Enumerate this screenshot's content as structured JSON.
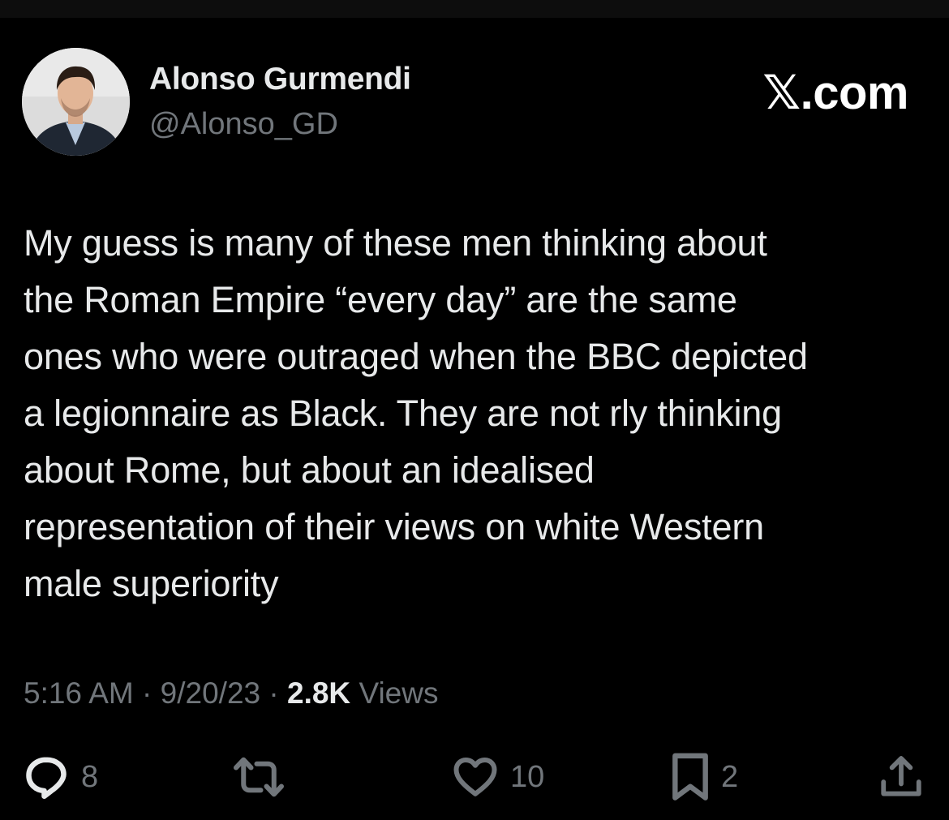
{
  "author": {
    "display_name": "Alonso Gurmendi",
    "handle": "@Alonso_GD",
    "avatar_icon": "profile-photo"
  },
  "brand": "𝕏.com",
  "tweet": {
    "text_lines": [
      "My guess is many of these men thinking about",
      "the Roman Empire “every day” are the same",
      "ones who were outraged when the BBC depicted",
      "a legionnaire as Black. They are not rly thinking",
      "about Rome, but about an idealised",
      "representation of their views on white Western",
      "male superiority"
    ]
  },
  "meta": {
    "time": "5:16 AM",
    "separator": "·",
    "date": "9/20/23",
    "views_count": "2.8K",
    "views_label": "Views"
  },
  "actions": {
    "reply": {
      "icon": "reply-icon",
      "count": "8"
    },
    "repost": {
      "icon": "repost-icon",
      "count": ""
    },
    "like": {
      "icon": "heart-icon",
      "count": "10"
    },
    "bookmark": {
      "icon": "bookmark-icon",
      "count": "2"
    },
    "share": {
      "icon": "share-icon"
    }
  },
  "colors": {
    "background": "#000000",
    "primary_text": "#e7e9ea",
    "secondary_text": "#71767b"
  }
}
